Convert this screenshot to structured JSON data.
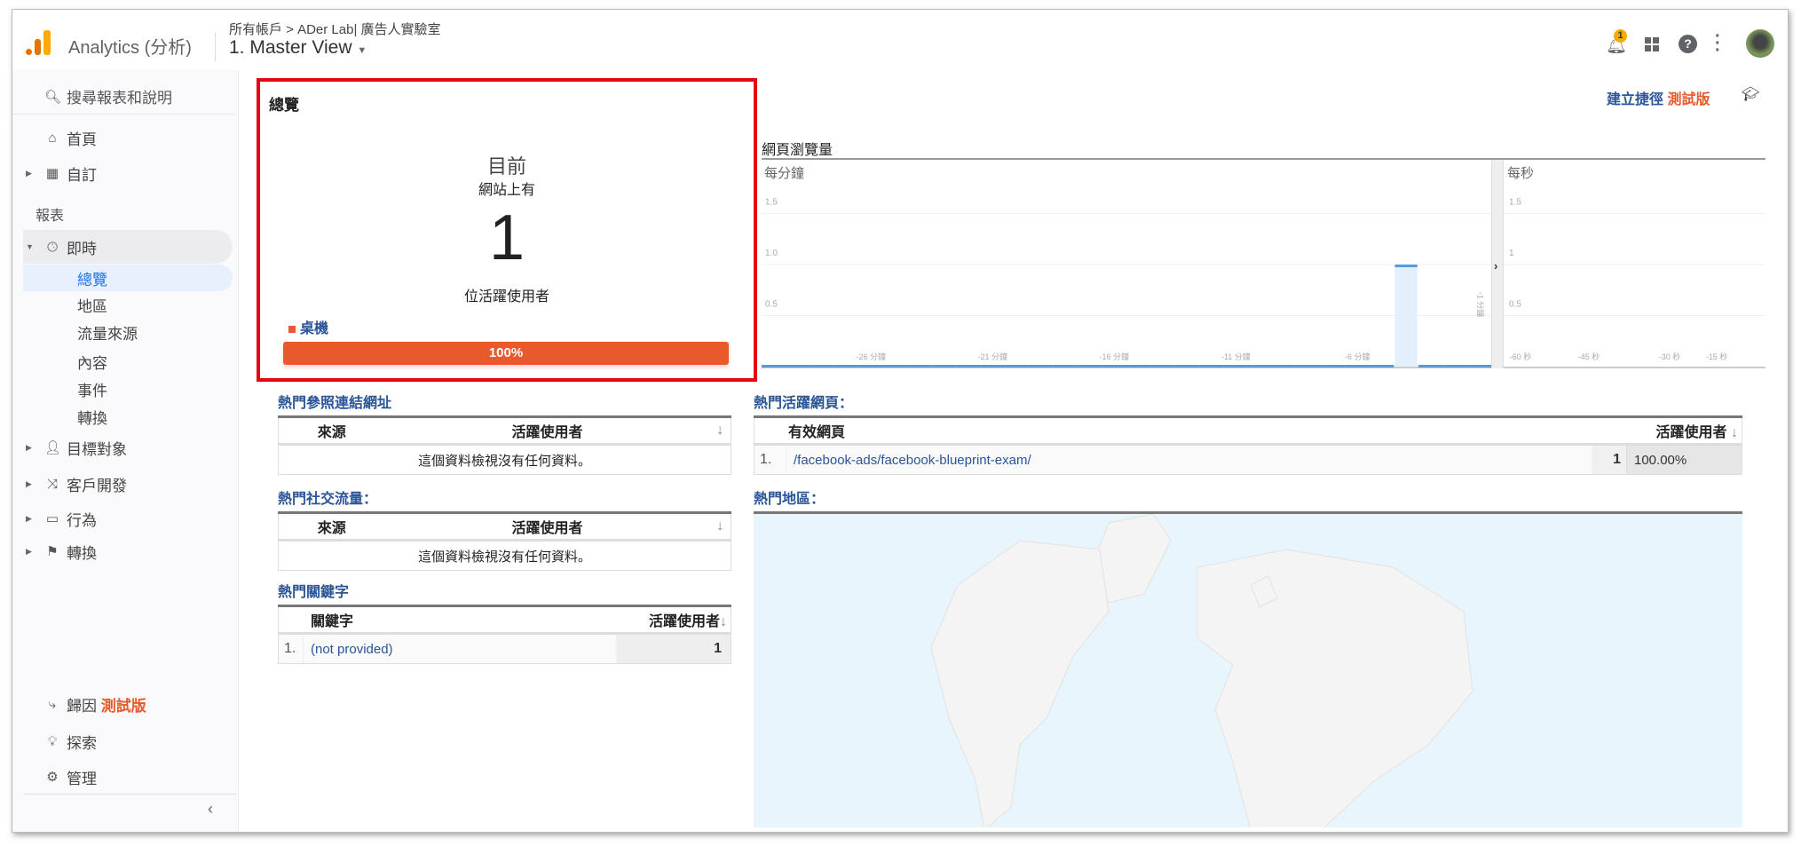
{
  "header": {
    "app_name": "Analytics (分析)",
    "breadcrumb": "所有帳戶 > ADer Lab| 廣告人實驗室",
    "view": "1. Master View",
    "notification_count": "1"
  },
  "sidebar": {
    "search": "搜尋報表和說明",
    "home": "首頁",
    "custom": "自訂",
    "reports_heading": "報表",
    "realtime": "即時",
    "realtime_sub": [
      "總覽",
      "地區",
      "流量來源",
      "內容",
      "事件",
      "轉換"
    ],
    "audience": "目標對象",
    "acquisition": "客戶開發",
    "behavior": "行為",
    "conversions": "轉換",
    "attribution": "歸因",
    "attribution_badge": "測試版",
    "discover": "探索",
    "admin": "管理"
  },
  "overview": {
    "title": "總覽",
    "now": "目前",
    "on_site": "網站上有",
    "active_users": "1",
    "active_label": "位活躍使用者",
    "device": "桌機",
    "device_percent": "100%",
    "device_fraction": 1.0,
    "colors": {
      "device": "#e8592c",
      "link": "#2a5597"
    }
  },
  "toolbar": {
    "shortcut": "建立捷徑",
    "beta": "測試版"
  },
  "chart_data": [
    {
      "type": "bar",
      "title": "網頁瀏覽量",
      "subtitle": "每分鐘",
      "x": [
        -30,
        -29,
        -28,
        -27,
        -26,
        -25,
        -24,
        -23,
        -22,
        -21,
        -20,
        -19,
        -18,
        -17,
        -16,
        -15,
        -14,
        -13,
        -12,
        -11,
        -10,
        -9,
        -8,
        -7,
        -6,
        -5,
        -4,
        -3,
        -2,
        -1
      ],
      "values": [
        0,
        0,
        0,
        0,
        0,
        0,
        0,
        0,
        0,
        0,
        0,
        0,
        0,
        0,
        0,
        0,
        0,
        0,
        0,
        0,
        0,
        0,
        0,
        0,
        0,
        0,
        1,
        0,
        0,
        0
      ],
      "ylim": [
        0,
        2
      ],
      "yticks": [
        "0.5",
        "1.0",
        "1.5"
      ],
      "xticks": [
        "-26 分鐘",
        "-21 分鐘",
        "-16 分鐘",
        "-11 分鐘",
        "-6 分鐘",
        "-1 分鐘"
      ]
    },
    {
      "type": "bar",
      "subtitle": "每秒",
      "ylim": [
        0,
        2
      ],
      "yticks": [
        "0.5",
        "1",
        "1.5"
      ],
      "xticks": [
        "-60 秒",
        "-45 秒",
        "-30 秒",
        "-15 秒"
      ],
      "values": []
    }
  ],
  "referrals": {
    "title": "熱門參照連結網址",
    "col_source": "來源",
    "col_users": "活躍使用者",
    "empty": "這個資料檢視沒有任何資料。"
  },
  "social": {
    "title": "熱門社交流量：",
    "col_source": "來源",
    "col_users": "活躍使用者",
    "empty": "這個資料檢視沒有任何資料。"
  },
  "keywords": {
    "title": "熱門關鍵字",
    "col_keyword": "關鍵字",
    "col_users": "活躍使用者",
    "rows": [
      {
        "n": "1.",
        "keyword": "(not provided)",
        "users": "1"
      }
    ]
  },
  "pages": {
    "title": "熱門活躍網頁：",
    "col_page": "有效網頁",
    "col_users": "活躍使用者",
    "rows": [
      {
        "n": "1.",
        "page": "/facebook-ads/facebook-blueprint-exam/",
        "users": "1",
        "pct": "100.00%"
      }
    ]
  },
  "locations": {
    "title": "熱門地區："
  }
}
